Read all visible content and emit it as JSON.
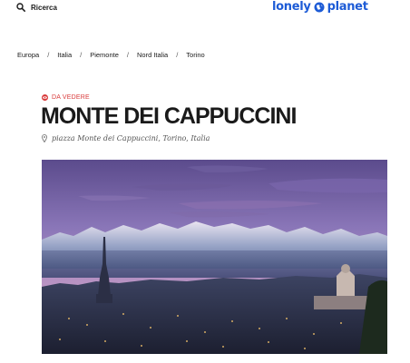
{
  "header": {
    "search_label": "Ricerca",
    "search_icon": "search-icon",
    "logo_left": "lonely",
    "logo_right": "planet",
    "logo_icon": "globe-icon",
    "brand_color": "#1d5bd6"
  },
  "breadcrumb": {
    "items": [
      "Europa",
      "Italia",
      "Piemonte",
      "Nord Italia",
      "Torino"
    ],
    "separator": "/"
  },
  "category": {
    "label": "DA VEDERE",
    "icon": "eye-icon",
    "color": "#d93b3b"
  },
  "page": {
    "title": "MONTE DEI CAPPUCCINI",
    "address": "piazza Monte dei Cappuccini, Torino, Italia",
    "address_icon": "map-pin-icon"
  },
  "hero": {
    "image": "turin-panorama-photo"
  }
}
